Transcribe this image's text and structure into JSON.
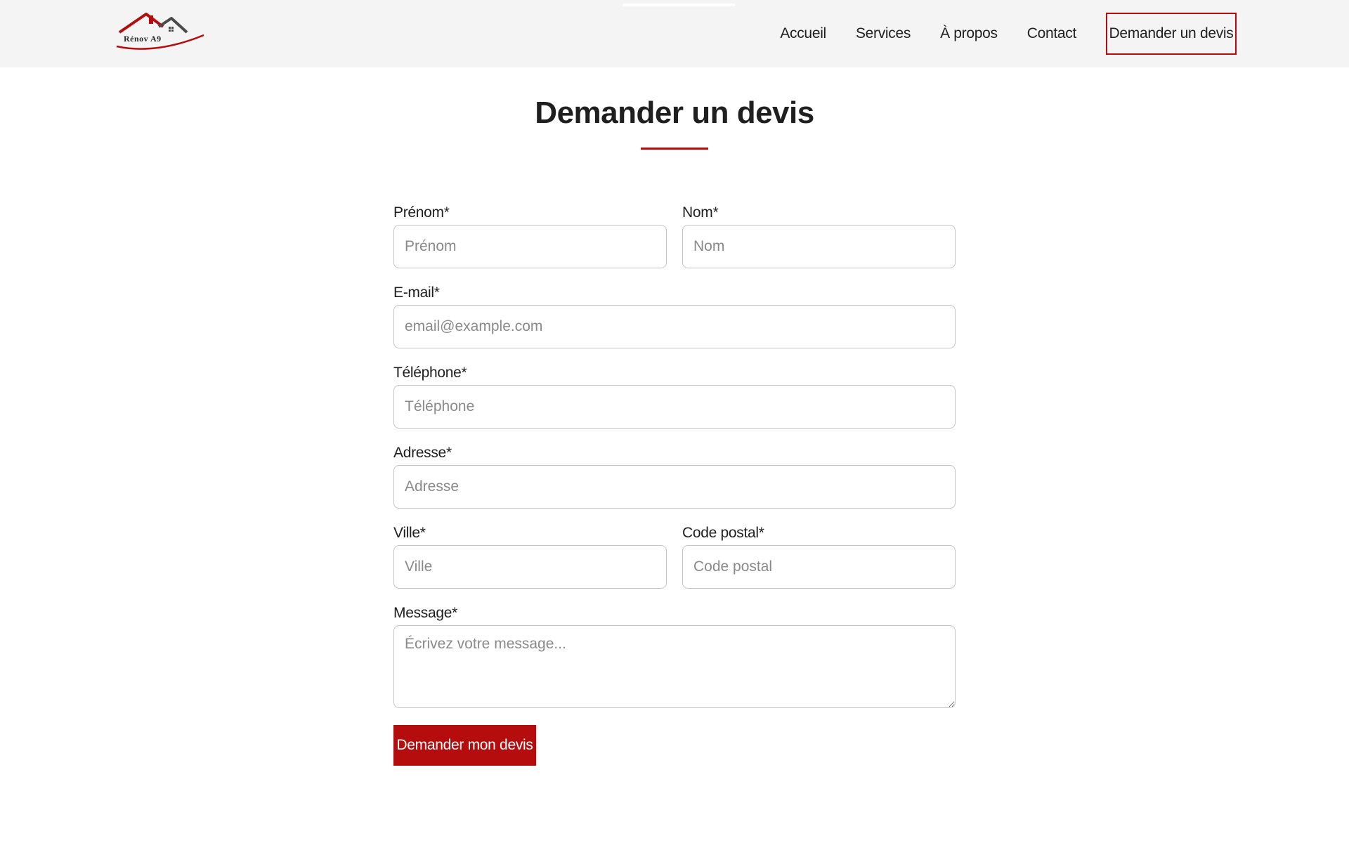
{
  "header": {
    "logo_text": "Rénov A9",
    "nav": [
      {
        "label": "Accueil"
      },
      {
        "label": "Services"
      },
      {
        "label": "À propos"
      },
      {
        "label": "Contact"
      }
    ],
    "cta_label": "Demander un devis"
  },
  "main": {
    "title": "Demander un devis"
  },
  "form": {
    "prenom": {
      "label": "Prénom*",
      "placeholder": "Prénom"
    },
    "nom": {
      "label": "Nom*",
      "placeholder": "Nom"
    },
    "email": {
      "label": "E-mail*",
      "placeholder": "email@example.com"
    },
    "telephone": {
      "label": "Téléphone*",
      "placeholder": "Téléphone"
    },
    "adresse": {
      "label": "Adresse*",
      "placeholder": "Adresse"
    },
    "ville": {
      "label": "Ville*",
      "placeholder": "Ville"
    },
    "code_postal": {
      "label": "Code postal*",
      "placeholder": "Code postal"
    },
    "message": {
      "label": "Message*",
      "placeholder": "Écrivez votre message..."
    },
    "submit_label": "Demander mon devis"
  },
  "colors": {
    "accent": "#b50d0d",
    "header_bg": "#f4f4f4",
    "text": "#1f1f1f",
    "input_border": "#c4c4c4"
  }
}
